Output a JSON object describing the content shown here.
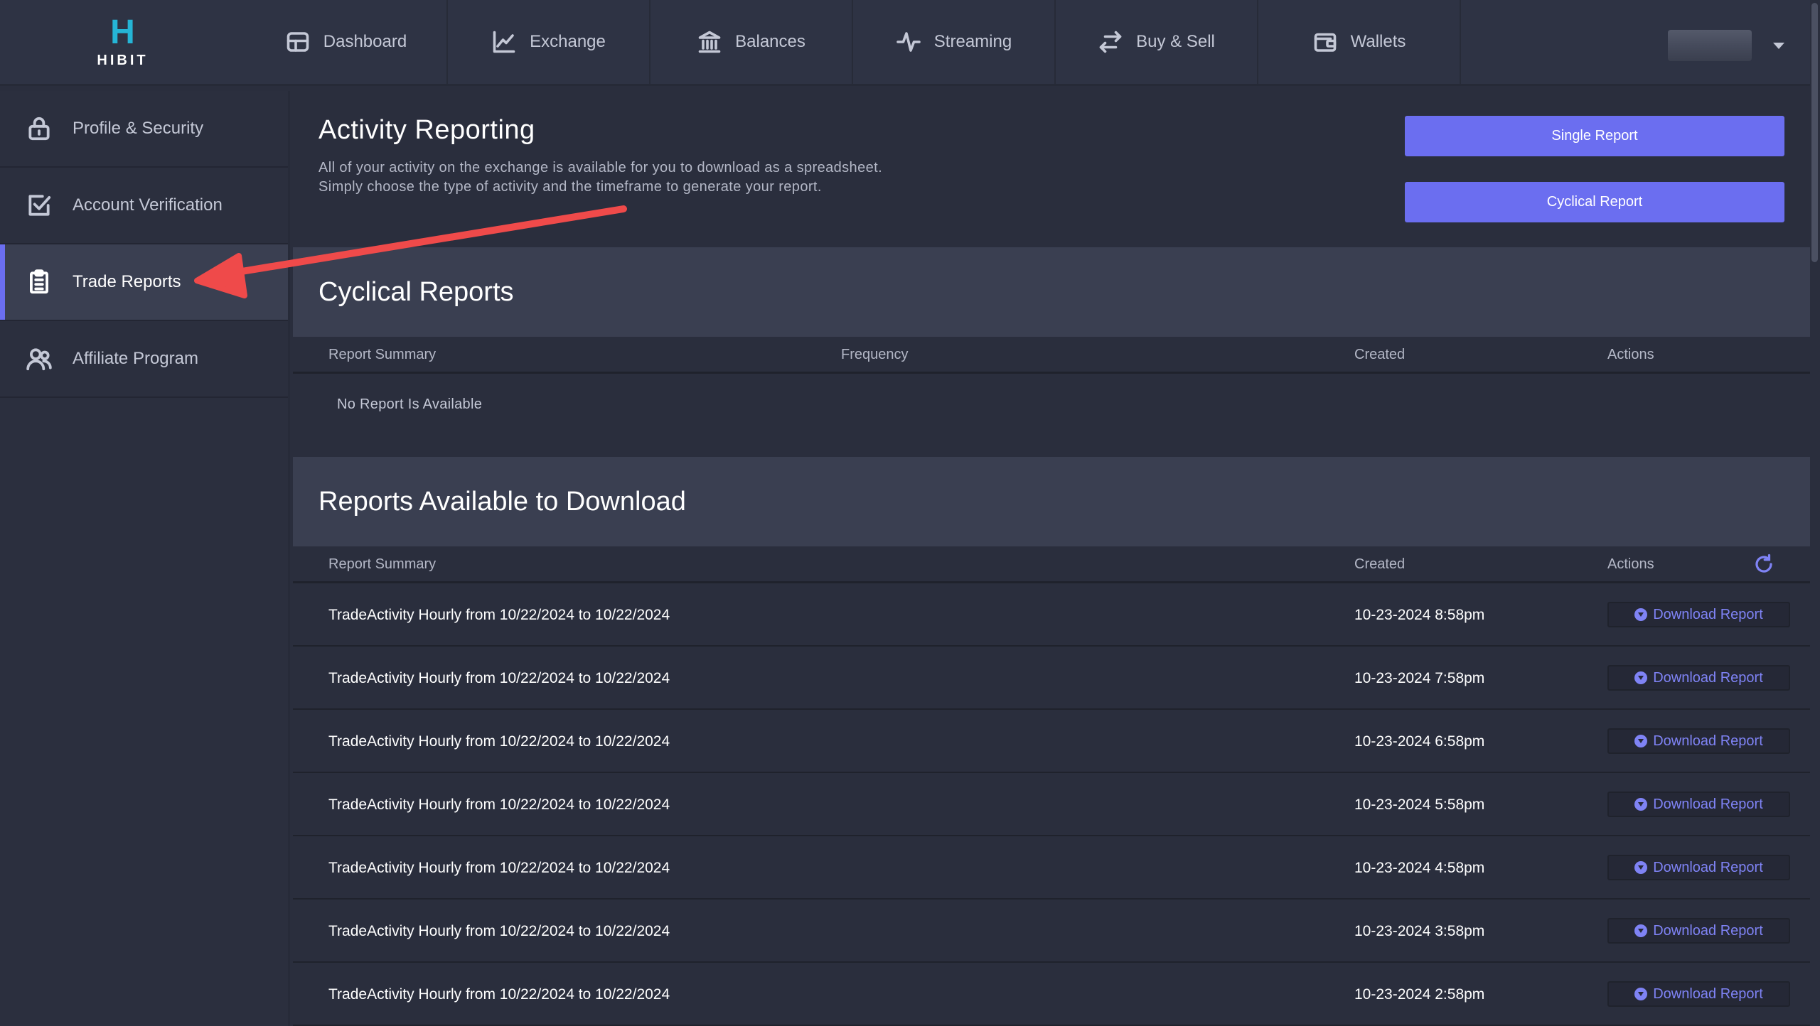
{
  "brand": {
    "mark": "H",
    "name": "HIBIT"
  },
  "nav": [
    {
      "label": "Dashboard",
      "icon": "dashboard-icon"
    },
    {
      "label": "Exchange",
      "icon": "chart-line-icon"
    },
    {
      "label": "Balances",
      "icon": "bank-icon"
    },
    {
      "label": "Streaming",
      "icon": "pulse-icon"
    },
    {
      "label": "Buy & Sell",
      "icon": "swap-arrows-icon"
    },
    {
      "label": "Wallets",
      "icon": "wallet-icon"
    }
  ],
  "sidebar": [
    {
      "label": "Profile & Security",
      "icon": "lock-icon",
      "active": false
    },
    {
      "label": "Account Verification",
      "icon": "checkbox-icon",
      "active": false
    },
    {
      "label": "Trade Reports",
      "icon": "clipboard-list-icon",
      "active": true
    },
    {
      "label": "Affiliate Program",
      "icon": "users-icon",
      "active": false
    }
  ],
  "activity": {
    "title": "Activity Reporting",
    "desc_line1": "All of your activity on the exchange is available for you to download as a spreadsheet.",
    "desc_line2": "Simply choose the type of activity and the timeframe to generate your report.",
    "single_btn": "Single Report",
    "cyclical_btn": "Cyclical Report"
  },
  "cyclical": {
    "title": "Cyclical Reports",
    "columns": {
      "summary": "Report Summary",
      "frequency": "Frequency",
      "created": "Created",
      "actions": "Actions"
    },
    "empty": "No Report Is Available"
  },
  "downloads": {
    "title": "Reports Available to Download",
    "columns": {
      "summary": "Report Summary",
      "created": "Created",
      "actions": "Actions"
    },
    "button_label": "Download Report",
    "rows": [
      {
        "summary": "TradeActivity Hourly from 10/22/2024 to 10/22/2024",
        "created": "10-23-2024 8:58pm"
      },
      {
        "summary": "TradeActivity Hourly from 10/22/2024 to 10/22/2024",
        "created": "10-23-2024 7:58pm"
      },
      {
        "summary": "TradeActivity Hourly from 10/22/2024 to 10/22/2024",
        "created": "10-23-2024 6:58pm"
      },
      {
        "summary": "TradeActivity Hourly from 10/22/2024 to 10/22/2024",
        "created": "10-23-2024 5:58pm"
      },
      {
        "summary": "TradeActivity Hourly from 10/22/2024 to 10/22/2024",
        "created": "10-23-2024 4:58pm"
      },
      {
        "summary": "TradeActivity Hourly from 10/22/2024 to 10/22/2024",
        "created": "10-23-2024 3:58pm"
      },
      {
        "summary": "TradeActivity Hourly from 10/22/2024 to 10/22/2024",
        "created": "10-23-2024 2:58pm"
      }
    ]
  },
  "colors": {
    "accent": "#6b6ef0",
    "annotation_arrow": "#ef4a4a",
    "logo": "#25b5d6"
  }
}
